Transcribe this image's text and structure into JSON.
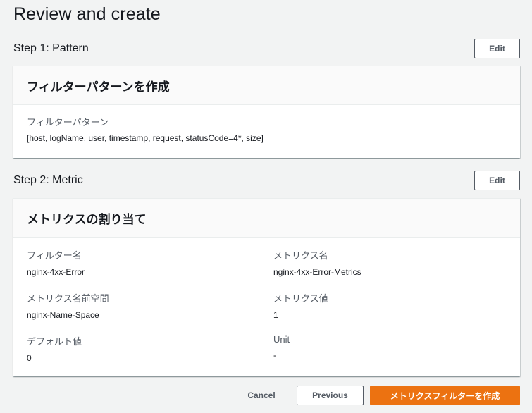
{
  "page": {
    "title": "Review and create"
  },
  "step1": {
    "title": "Step 1: Pattern",
    "edit_label": "Edit",
    "card_title": "フィルターパターンを作成",
    "field_label": "フィルターパターン",
    "field_value": "[host, logName, user, timestamp, request, statusCode=4*, size]"
  },
  "step2": {
    "title": "Step 2: Metric",
    "edit_label": "Edit",
    "card_title": "メトリクスの割り当て",
    "fields": {
      "filter_name": {
        "label": "フィルター名",
        "value": "nginx-4xx-Error"
      },
      "metric_name": {
        "label": "メトリクス名",
        "value": "nginx-4xx-Error-Metrics"
      },
      "namespace": {
        "label": "メトリクス名前空間",
        "value": "nginx-Name-Space"
      },
      "metric_value": {
        "label": "メトリクス値",
        "value": "1"
      },
      "default_value": {
        "label": "デフォルト値",
        "value": "0"
      },
      "unit": {
        "label": "Unit",
        "value": "-"
      }
    }
  },
  "footer": {
    "cancel_label": "Cancel",
    "previous_label": "Previous",
    "create_label": "メトリクスフィルターを作成"
  },
  "colors": {
    "primary_button": "#ec7211",
    "background": "#f2f3f3"
  }
}
